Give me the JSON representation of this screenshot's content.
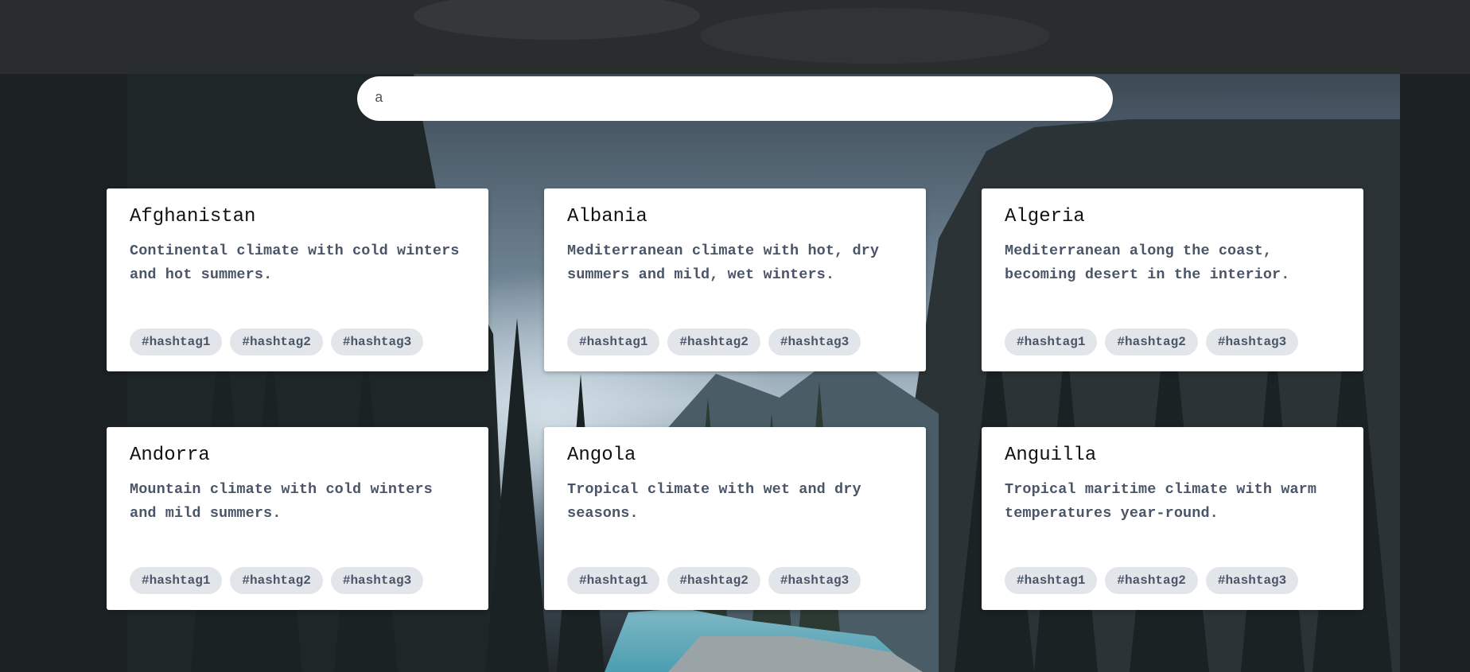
{
  "search": {
    "value": "a",
    "placeholder": ""
  },
  "cards": [
    {
      "title": "Afghanistan",
      "description": "Continental climate with cold winters and hot summers.",
      "tags": [
        "#hashtag1",
        "#hashtag2",
        "#hashtag3"
      ]
    },
    {
      "title": "Albania",
      "description": "Mediterranean climate with hot, dry summers and mild, wet winters.",
      "tags": [
        "#hashtag1",
        "#hashtag2",
        "#hashtag3"
      ]
    },
    {
      "title": "Algeria",
      "description": "Mediterranean along the coast, becoming desert in the interior.",
      "tags": [
        "#hashtag1",
        "#hashtag2",
        "#hashtag3"
      ]
    },
    {
      "title": "Andorra",
      "description": "Mountain climate with cold winters and mild summers.",
      "tags": [
        "#hashtag1",
        "#hashtag2",
        "#hashtag3"
      ]
    },
    {
      "title": "Angola",
      "description": "Tropical climate with wet and dry seasons.",
      "tags": [
        "#hashtag1",
        "#hashtag2",
        "#hashtag3"
      ]
    },
    {
      "title": "Anguilla",
      "description": "Tropical maritime climate with warm temperatures year-round.",
      "tags": [
        "#hashtag1",
        "#hashtag2",
        "#hashtag3"
      ]
    }
  ],
  "colors": {
    "card_bg": "#ffffff",
    "tag_bg": "#e2e5ea",
    "text_muted": "#4a5568",
    "page_bg": "#1f2224"
  }
}
